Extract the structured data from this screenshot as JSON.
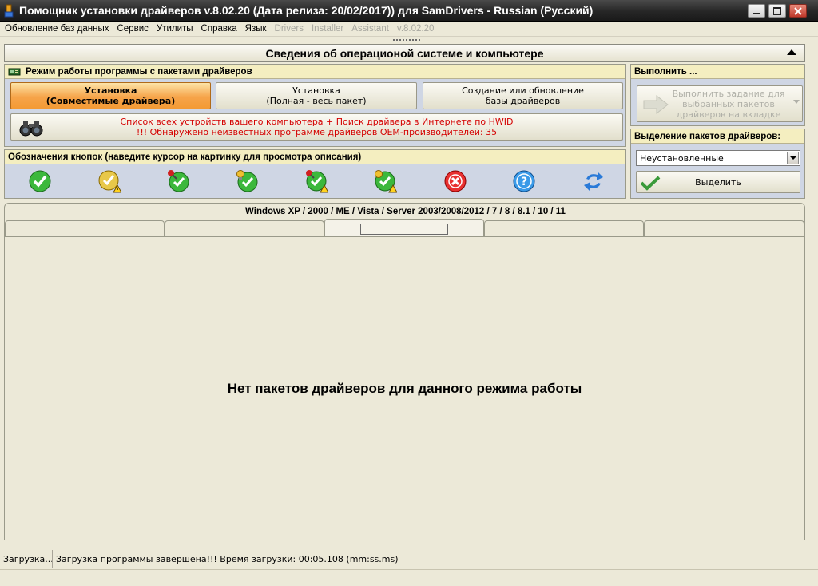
{
  "window": {
    "title": "Помощник установки драйверов v.8.02.20 (Дата релиза: 20/02/2017)) для SamDrivers - Russian (Русский)"
  },
  "menu": {
    "items": [
      {
        "label": "Обновление баз данных",
        "enabled": true
      },
      {
        "label": "Сервис",
        "enabled": true
      },
      {
        "label": "Утилиты",
        "enabled": true
      },
      {
        "label": "Справка",
        "enabled": true
      },
      {
        "label": "Язык",
        "enabled": true
      },
      {
        "label": "Drivers",
        "enabled": false
      },
      {
        "label": "Installer",
        "enabled": false
      },
      {
        "label": "Assistant",
        "enabled": false
      },
      {
        "label": "v.8.02.20",
        "enabled": false
      }
    ]
  },
  "info_header": {
    "title": "Сведения об операционой системе и компьютере"
  },
  "mode_panel": {
    "heading": "Режим работы программы с пакетами драйверов",
    "buttons": [
      {
        "line1": "Установка",
        "line2": "(Совместимые драйвера)",
        "active": true
      },
      {
        "line1": "Установка",
        "line2": "(Полная - весь пакет)",
        "active": false
      },
      {
        "line1": "Создание или обновление",
        "line2": "базы драйверов",
        "active": false
      }
    ],
    "devices_line1": "Список всех устройств вашего компьютера + Поиск драйвера в Интернете по HWID",
    "devices_line2": "!!! Обнаружено неизвестных программе драйверов OEM-производителей: 35"
  },
  "execute_panel": {
    "heading": "Выполнить ...",
    "button_line1": "Выполнить задание для",
    "button_line2": "выбранных пакетов",
    "button_line3": "драйверов на вкладке"
  },
  "legend_panel": {
    "heading": "Обозначения кнопок (наведите курсор на картинку для просмотра описания)",
    "icons": [
      "check-icon",
      "check-warning-icon",
      "check-pin-icon",
      "check-bulb-icon",
      "check-pin-warning-icon",
      "check-bulb-warning-icon",
      "error-icon",
      "help-icon",
      "refresh-icon"
    ]
  },
  "select_panel": {
    "heading": "Выделение пакетов драйверов:",
    "dropdown_value": "Неустановленные",
    "select_button": "Выделить"
  },
  "tabs": {
    "os_title": "Windows XP / 2000 / ME / Vista / Server 2003/2008/2012 / 7 / 8 / 8.1 / 10 / 11",
    "active_index": 2,
    "empty_message": "Нет пакетов драйверов для данного режима работы"
  },
  "status": {
    "left": "Загрузка...",
    "message": "Загрузка программы завершена!!! Время загрузки: 00:05.108 (mm:ss.ms)"
  },
  "colors": {
    "active_mode": "#f6a44a",
    "panel_head": "#f4eec0",
    "panel_bg": "#cfd6e4",
    "device_text": "#d40000"
  }
}
